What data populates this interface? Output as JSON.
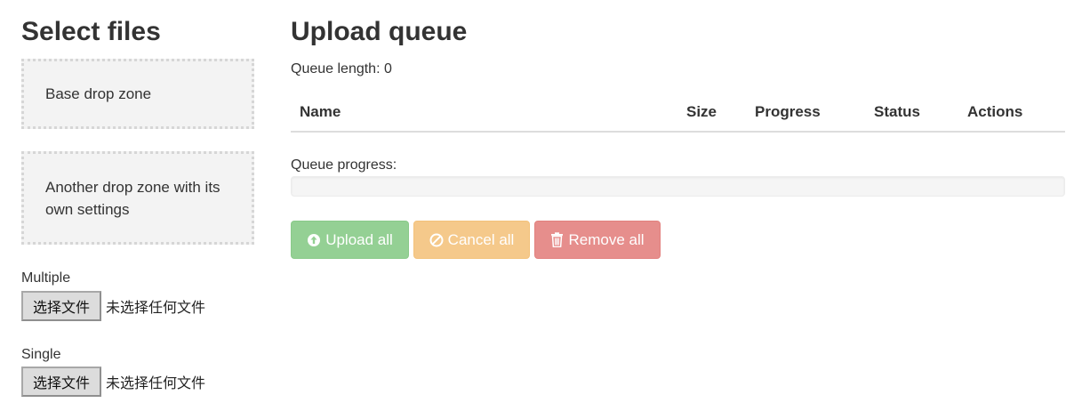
{
  "left": {
    "title": "Select files",
    "drop_zone_base": "Base drop zone",
    "drop_zone_other": "Another drop zone with its own settings",
    "multiple_label": "Multiple",
    "single_label": "Single",
    "file_button_label": "选择文件",
    "no_file_text": "未选择任何文件"
  },
  "right": {
    "title": "Upload queue",
    "queue_length": "Queue length: 0",
    "columns": {
      "name": "Name",
      "size": "Size",
      "progress": "Progress",
      "status": "Status",
      "actions": "Actions"
    },
    "queue_progress_label": "Queue progress:",
    "queue_progress_value": 0,
    "buttons": {
      "upload_all": "Upload all",
      "cancel_all": "Cancel all",
      "remove_all": "Remove all"
    }
  },
  "icons": {
    "upload": "circle-arrow-up-icon",
    "cancel": "ban-icon",
    "remove": "trash-icon"
  },
  "colors": {
    "success": "#5cb85c",
    "warning": "#f0ad4e",
    "danger": "#d9534f",
    "drop_zone_bg": "#f3f3f3"
  }
}
